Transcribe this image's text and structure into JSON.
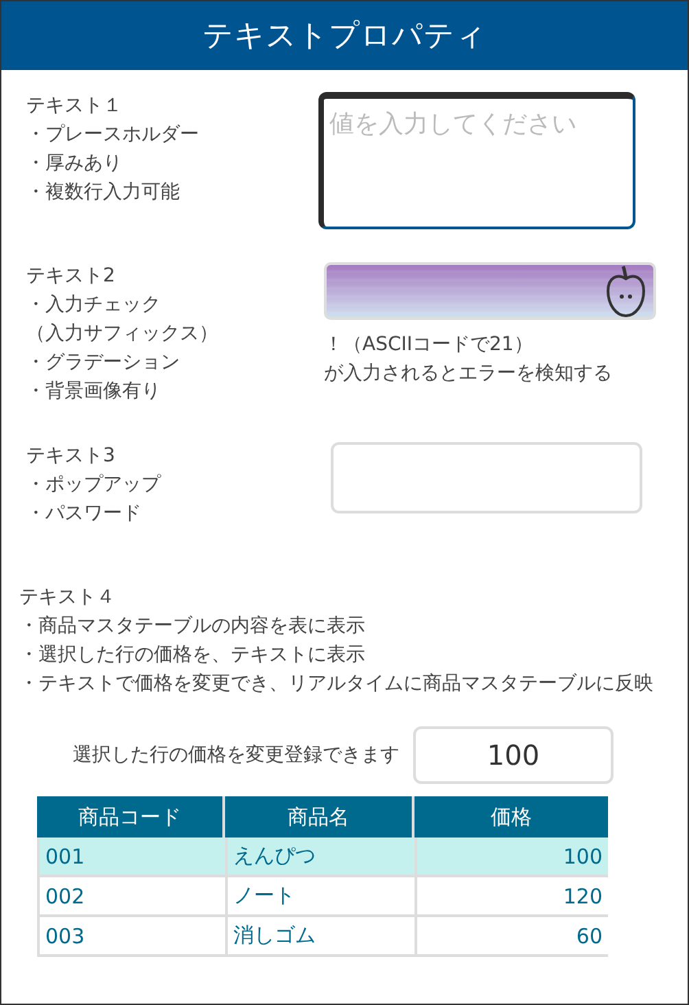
{
  "window": {
    "title": "テキストプロパティ"
  },
  "sections": [
    {
      "kind": "textarea",
      "title": "テキスト１",
      "lines": [
        "・プレースホルダー",
        "・厚みあり",
        "・複数行入力可能"
      ],
      "field": {
        "placeholder": "値を入力してください"
      }
    },
    {
      "kind": "gradient",
      "title": "テキスト2",
      "lines": [
        "・入力チェック",
        "（入力サフィックス）",
        "・グラデーション",
        "・背景画像有り"
      ],
      "notes": [
        "！（ASCIIコードで21）",
        "が入力されるとエラーを検知する"
      ]
    },
    {
      "kind": "password",
      "title": "テキスト3",
      "lines": [
        "・ポップアップ",
        "・パスワード"
      ]
    }
  ],
  "section4": {
    "title": "テキスト４",
    "lines": [
      "・商品マスタテーブルの内容を表に表示",
      "・選択した行の価格を、テキストに表示",
      "・テキストで価格を変更でき、リアルタイムに商品マスタテーブルに反映"
    ]
  },
  "price_field": {
    "label": "選択した行の価格を変更登録できます",
    "value": "100"
  },
  "table": {
    "columns": [
      "商品コード",
      "商品名",
      "価格"
    ],
    "rows": [
      {
        "cells": [
          "001",
          "えんぴつ",
          "100"
        ],
        "selected": true
      },
      {
        "cells": [
          "002",
          "ノート",
          "120"
        ],
        "selected": false
      },
      {
        "cells": [
          "003",
          "消しゴム",
          "60"
        ],
        "selected": false
      }
    ]
  }
}
